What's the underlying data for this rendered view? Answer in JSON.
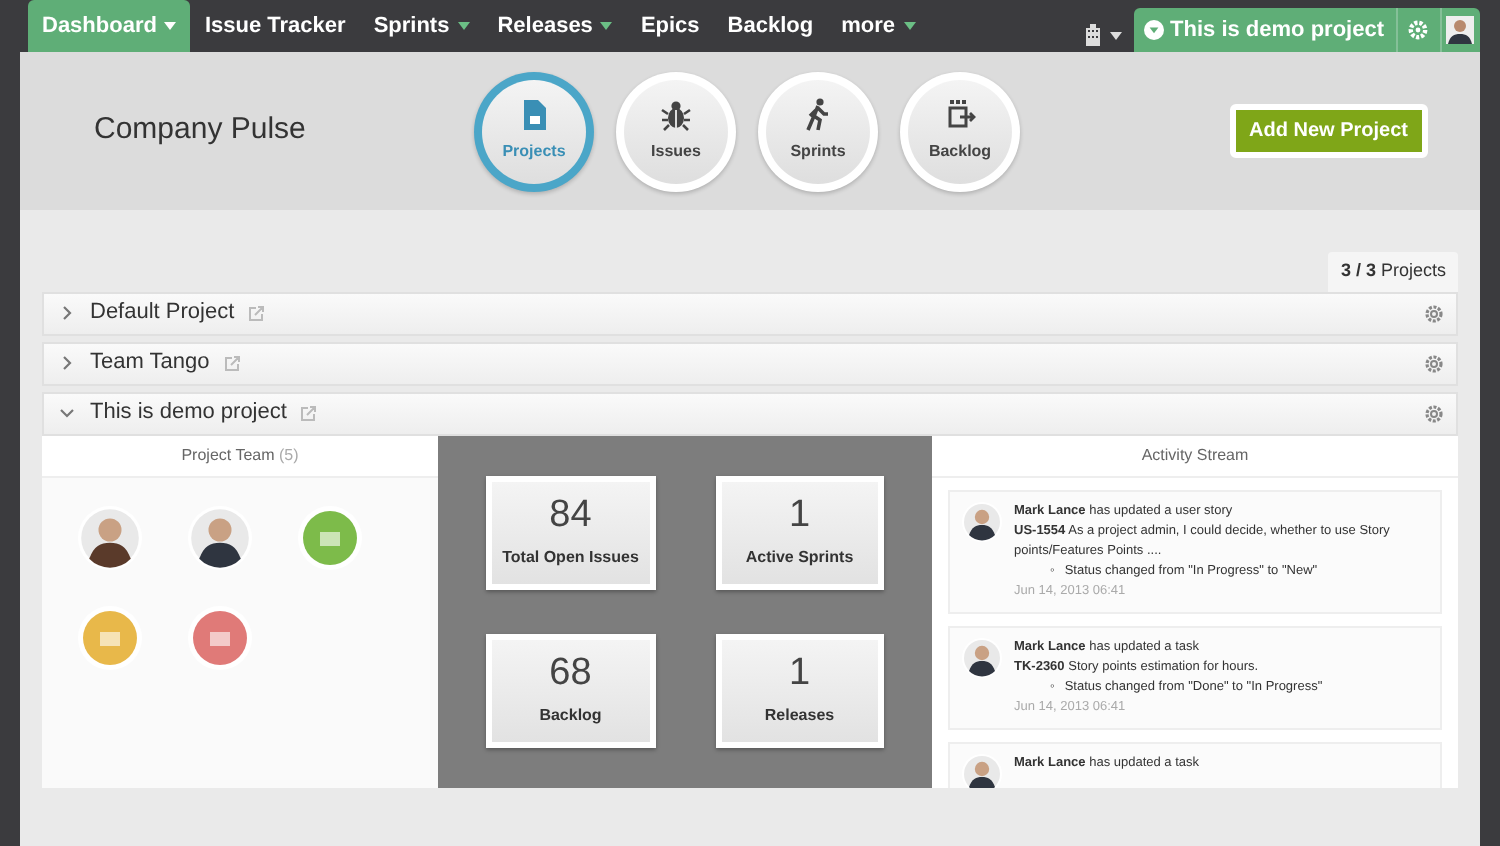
{
  "nav": [
    {
      "label": "Dashboard",
      "dropdown": true,
      "selected": true
    },
    {
      "label": "Issue Tracker",
      "dropdown": false,
      "selected": false
    },
    {
      "label": "Sprints",
      "dropdown": true,
      "selected": false
    },
    {
      "label": "Releases",
      "dropdown": true,
      "selected": false
    },
    {
      "label": "Epics",
      "dropdown": false,
      "selected": false
    },
    {
      "label": "Backlog",
      "dropdown": false,
      "selected": false
    },
    {
      "label": "more",
      "dropdown": true,
      "selected": false
    }
  ],
  "project_switcher": {
    "label": "This is demo project"
  },
  "header": {
    "title": "Company Pulse",
    "add_button": "Add New Project"
  },
  "modules": [
    {
      "kind": "projects",
      "label": "Projects",
      "selected": true
    },
    {
      "kind": "issues",
      "label": "Issues",
      "selected": false
    },
    {
      "kind": "sprints",
      "label": "Sprints",
      "selected": false
    },
    {
      "kind": "backlog",
      "label": "Backlog",
      "selected": false
    }
  ],
  "project_count": {
    "count": "3 / 3",
    "label": "Projects"
  },
  "projects": [
    {
      "name": "Default Project",
      "expanded": false
    },
    {
      "name": "Team Tango",
      "expanded": false
    },
    {
      "name": "This is demo project",
      "expanded": true
    }
  ],
  "team": {
    "title": "Project Team",
    "count": "(5)",
    "members": [
      {
        "kind": "person",
        "color": "#5a3a2a"
      },
      {
        "kind": "person",
        "color": "#2f3540"
      },
      {
        "kind": "app",
        "color": "#7dbb4a"
      },
      {
        "kind": "app",
        "color": "#e8b84a"
      },
      {
        "kind": "app",
        "color": "#e07a78"
      }
    ]
  },
  "stats": [
    {
      "value": "84",
      "label": "Total Open Issues"
    },
    {
      "value": "1",
      "label": "Active Sprints"
    },
    {
      "value": "68",
      "label": "Backlog"
    },
    {
      "value": "1",
      "label": "Releases"
    }
  ],
  "activity": {
    "title": "Activity Stream",
    "items": [
      {
        "line": "**Mark Lance** has updated a user story",
        "detail": "**US-1554** As a project admin, I could decide, whether to use Story points/Features Points ....",
        "change_marker": "◦",
        "change": "Status changed from \"In Progress\" to \"New\"",
        "time": "Jun 14, 2013 06:41"
      },
      {
        "line": "**Mark Lance** has updated a task",
        "detail": "**TK-2360** Story points estimation for hours.",
        "change_marker": "◦",
        "change": "Status changed from \"Done\" to \"In Progress\"",
        "time": "Jun 14, 2013 06:41"
      },
      {
        "line": "**Mark Lance** has updated a task"
      }
    ]
  }
}
